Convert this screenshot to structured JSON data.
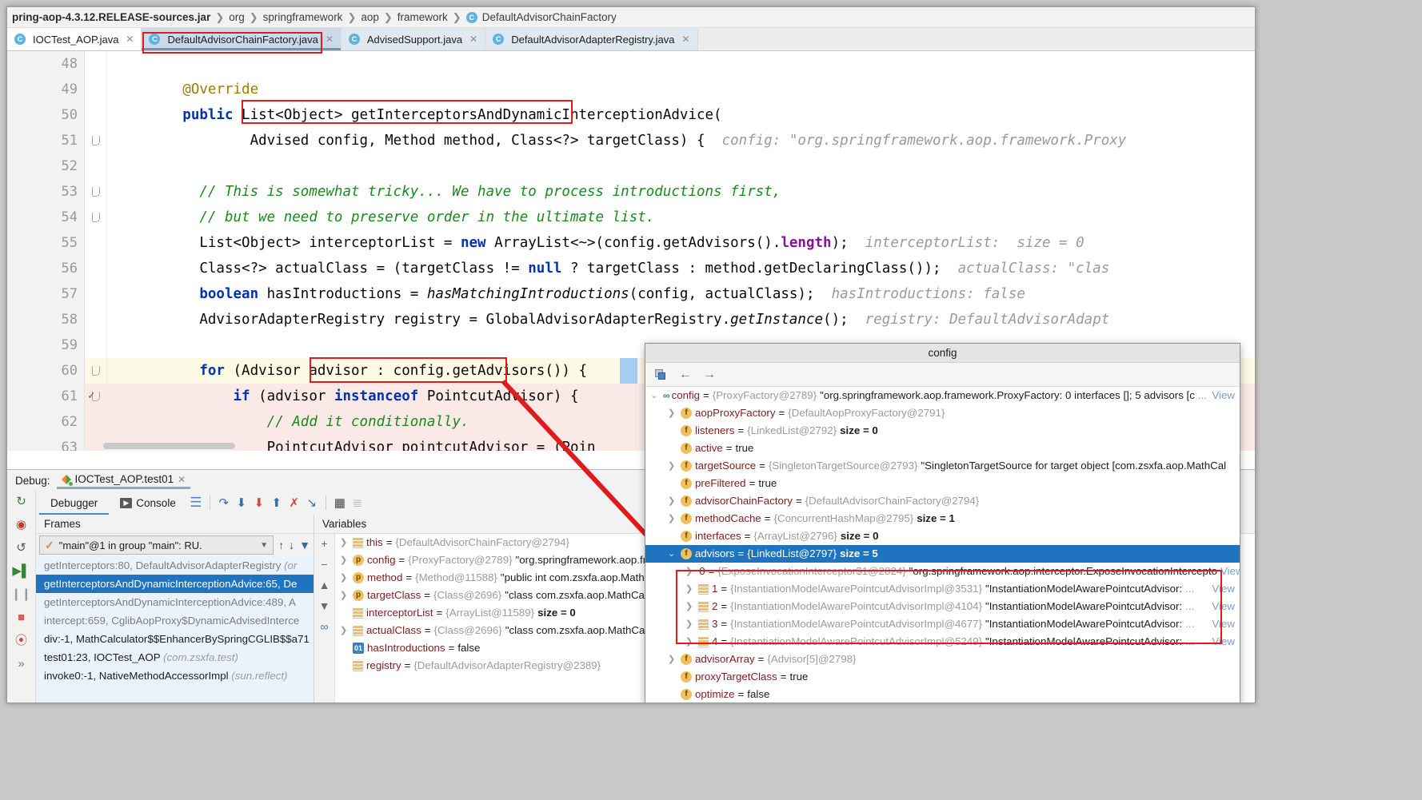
{
  "breadcrumb": {
    "root": "pring-aop-4.3.12.RELEASE-sources.jar",
    "items": [
      "org",
      "springframework",
      "aop",
      "framework"
    ],
    "leaf": "DefaultAdvisorChainFactory",
    "leaf_badge": "C"
  },
  "editor_tabs": [
    {
      "label": "IOCTest_AOP.java",
      "badge": "C",
      "active": false
    },
    {
      "label": "DefaultAdvisorChainFactory.java",
      "badge": "C",
      "active": true
    },
    {
      "label": "AdvisedSupport.java",
      "badge": "C",
      "active": false
    },
    {
      "label": "DefaultAdvisorAdapterRegistry.java",
      "badge": "C",
      "active": false
    }
  ],
  "code": {
    "lines": [
      {
        "num": "48",
        "segments": []
      },
      {
        "num": "49",
        "segments": [
          {
            "t": "        ",
            "c": ""
          },
          {
            "t": "@Override",
            "c": "ann"
          }
        ]
      },
      {
        "num": "50",
        "segments": [
          {
            "t": "        ",
            "c": ""
          },
          {
            "t": "public",
            "c": "kw"
          },
          {
            "t": " List<Object> getInterceptorsAndDynamicInterceptionAdvice(",
            "c": ""
          }
        ],
        "marks": [
          "breakpoint-green",
          "arrow-up"
        ]
      },
      {
        "num": "51",
        "segments": [
          {
            "t": "                Advised config, Method method, Class<?> targetClass) {  ",
            "c": ""
          },
          {
            "t": "config: \"org.springframework.aop.framework.Proxy",
            "c": "hint"
          }
        ],
        "fold": true
      },
      {
        "num": "52",
        "segments": []
      },
      {
        "num": "53",
        "segments": [
          {
            "t": "          ",
            "c": ""
          },
          {
            "t": "// This is somewhat tricky... We have to process introductions first,",
            "c": "cmt"
          }
        ],
        "fold": true
      },
      {
        "num": "54",
        "segments": [
          {
            "t": "          ",
            "c": ""
          },
          {
            "t": "// but we need to preserve order in the ultimate list.",
            "c": "cmt"
          }
        ],
        "fold": true
      },
      {
        "num": "55",
        "segments": [
          {
            "t": "          List<Object> interceptorList = ",
            "c": ""
          },
          {
            "t": "new",
            "c": "kw"
          },
          {
            "t": " ArrayList<~>(config.getAdvisors().",
            "c": ""
          },
          {
            "t": "length",
            "c": "fld"
          },
          {
            "t": ");  ",
            "c": ""
          },
          {
            "t": "interceptorList:  size = 0",
            "c": "hint"
          }
        ]
      },
      {
        "num": "56",
        "segments": [
          {
            "t": "          Class<?> actualClass = (targetClass != ",
            "c": ""
          },
          {
            "t": "null",
            "c": "kw"
          },
          {
            "t": " ? targetClass : method.getDeclaringClass());  ",
            "c": ""
          },
          {
            "t": "actualClass: \"clas",
            "c": "hint"
          }
        ]
      },
      {
        "num": "57",
        "segments": [
          {
            "t": "          ",
            "c": ""
          },
          {
            "t": "boolean",
            "c": "kw"
          },
          {
            "t": " hasIntroductions = ",
            "c": ""
          },
          {
            "t": "hasMatchingIntroductions",
            "c": "ital"
          },
          {
            "t": "(config, actualClass);  ",
            "c": ""
          },
          {
            "t": "hasIntroductions: false",
            "c": "hint"
          }
        ]
      },
      {
        "num": "58",
        "segments": [
          {
            "t": "          AdvisorAdapterRegistry registry = GlobalAdvisorAdapterRegistry.",
            "c": ""
          },
          {
            "t": "getInstance",
            "c": "ital"
          },
          {
            "t": "();  ",
            "c": ""
          },
          {
            "t": "registry: DefaultAdvisorAdapt",
            "c": "hint"
          }
        ]
      },
      {
        "num": "59",
        "segments": []
      },
      {
        "num": "60",
        "segments": [
          {
            "t": "          ",
            "c": ""
          },
          {
            "t": "for",
            "c": "kw"
          },
          {
            "t": " (Advisor advisor : config.getAdvisors()) {",
            "c": ""
          }
        ],
        "hl": "yellow",
        "fold": true
      },
      {
        "num": "61",
        "segments": [
          {
            "t": "              ",
            "c": ""
          },
          {
            "t": "if",
            "c": "kw"
          },
          {
            "t": " (advisor ",
            "c": ""
          },
          {
            "t": "instanceof",
            "c": "kw"
          },
          {
            "t": " PointcutAdvisor) {",
            "c": ""
          }
        ],
        "hl": "pink",
        "marks": [
          "breakpoint-red"
        ],
        "fold": true
      },
      {
        "num": "62",
        "segments": [
          {
            "t": "                  ",
            "c": ""
          },
          {
            "t": "// Add it conditionally.",
            "c": "cmt"
          }
        ],
        "hl": "pink"
      },
      {
        "num": "63",
        "segments": [
          {
            "t": "                  PointcutAdvisor pointcutAdvisor = (Poin",
            "c": ""
          }
        ],
        "hl": "pink"
      }
    ]
  },
  "debug": {
    "label": "Debug:",
    "run_config": "IOCTest_AOP.test01",
    "tabs": [
      {
        "label": "Debugger",
        "active": true
      },
      {
        "label": "Console",
        "active": false
      }
    ],
    "toolbar_icons": [
      "mute-breakpoints-icon",
      "step-over-icon",
      "step-into-icon",
      "force-step-into-icon",
      "step-out-icon",
      "drop-frame-icon",
      "run-to-cursor-icon",
      "evaluate-expression-icon",
      "settings-icon"
    ],
    "rail_icons": [
      "rerun-icon",
      "view-breakpoints-icon",
      "restore-layout-icon",
      "resume-icon",
      "pause-icon",
      "stop-icon",
      "mute-breakpoints-rail-icon",
      "more-icon"
    ],
    "frames_title": "Frames",
    "thread": "\"main\"@1 in group \"main\": RU.",
    "frames": [
      {
        "text": "getInterceptors:80, DefaultAdvisorAdapterRegistry ",
        "lib": "(or",
        "selected": false,
        "dark": false
      },
      {
        "text": "getInterceptorsAndDynamicInterceptionAdvice:65, De",
        "lib": "",
        "selected": true,
        "dark": false
      },
      {
        "text": "getInterceptorsAndDynamicInterceptionAdvice:489, A",
        "lib": "",
        "selected": false,
        "dark": false
      },
      {
        "text": "intercept:659, CglibAopProxy$DynamicAdvisedInterce",
        "lib": "",
        "selected": false,
        "dark": false
      },
      {
        "text": "div:-1, MathCalculator$$EnhancerBySpringCGLIB$$a71",
        "lib": "",
        "selected": false,
        "dark": true
      },
      {
        "text": "test01:23, IOCTest_AOP ",
        "lib": "(com.zsxfa.test)",
        "selected": false,
        "dark": true
      },
      {
        "text": "invoke0:-1, NativeMethodAccessorImpl ",
        "lib": "(sun.reflect)",
        "selected": false,
        "dark": true
      }
    ],
    "vars_title": "Variables",
    "variables": [
      {
        "icon": "local",
        "name": "this",
        "ref": "{DefaultAdvisorChainFactory@2794}",
        "str": "",
        "size": "",
        "expandable": true
      },
      {
        "icon": "param",
        "name": "config",
        "ref": "{ProxyFactory@2789}",
        "str": "\"org.springframework.aop.fr",
        "size": "",
        "expandable": true
      },
      {
        "icon": "param",
        "name": "method",
        "ref": "{Method@11588}",
        "str": "\"public int com.zsxfa.aop.Math",
        "size": "",
        "expandable": true
      },
      {
        "icon": "param",
        "name": "targetClass",
        "ref": "{Class@2696}",
        "str": "\"class com.zsxfa.aop.MathCalcu",
        "size": "",
        "expandable": true
      },
      {
        "icon": "local",
        "name": "interceptorList",
        "ref": "{ArrayList@11589}",
        "str": "",
        "size": "size = 0",
        "expandable": false
      },
      {
        "icon": "local",
        "name": "actualClass",
        "ref": "{Class@2696}",
        "str": "\"class com.zsxfa.aop.MathCalcu",
        "size": "",
        "expandable": true
      },
      {
        "icon": "bool",
        "name": "hasIntroductions",
        "ref": "",
        "str": "false",
        "size": "",
        "expandable": false
      },
      {
        "icon": "local",
        "name": "registry",
        "ref": "{DefaultAdvisorAdapterRegistry@2389}",
        "str": "",
        "size": "",
        "expandable": false
      }
    ]
  },
  "popup": {
    "title": "config",
    "toolbar_icons": [
      "watch-icon",
      "back-arrow-icon",
      "forward-arrow-icon"
    ],
    "rows": [
      {
        "indent": 0,
        "twisty": "v",
        "icon": "oo",
        "name": "config",
        "ref": "{ProxyFactory@2789}",
        "str": "\"org.springframework.aop.framework.ProxyFactory: 0 interfaces []; 5 advisors [c",
        "ell": "...",
        "view": "View",
        "selected": false
      },
      {
        "indent": 1,
        "twisty": ">",
        "icon": "field",
        "name": "aopProxyFactory",
        "ref": "{DefaultAopProxyFactory@2791}",
        "str": "",
        "ell": "",
        "view": "",
        "selected": false
      },
      {
        "indent": 1,
        "twisty": "",
        "icon": "field",
        "name": "listeners",
        "ref": "{LinkedList@2792}",
        "str": "",
        "size": "size = 0",
        "ell": "",
        "view": "",
        "selected": false
      },
      {
        "indent": 1,
        "twisty": "",
        "icon": "field",
        "name": "active",
        "ref": "",
        "str": "true",
        "ell": "",
        "view": "",
        "selected": false
      },
      {
        "indent": 1,
        "twisty": ">",
        "icon": "field",
        "name": "targetSource",
        "ref": "{SingletonTargetSource@2793}",
        "str": "\"SingletonTargetSource for target object [com.zsxfa.aop.MathCal",
        "ell": "",
        "view": "",
        "selected": false
      },
      {
        "indent": 1,
        "twisty": "",
        "icon": "field",
        "name": "preFiltered",
        "ref": "",
        "str": "true",
        "ell": "",
        "view": "",
        "selected": false
      },
      {
        "indent": 1,
        "twisty": ">",
        "icon": "field",
        "name": "advisorChainFactory",
        "ref": "{DefaultAdvisorChainFactory@2794}",
        "str": "",
        "ell": "",
        "view": "",
        "selected": false
      },
      {
        "indent": 1,
        "twisty": ">",
        "icon": "field",
        "name": "methodCache",
        "ref": "{ConcurrentHashMap@2795}",
        "str": "",
        "size": "size = 1",
        "ell": "",
        "view": "",
        "selected": false
      },
      {
        "indent": 1,
        "twisty": "",
        "icon": "field",
        "name": "interfaces",
        "ref": "{ArrayList@2796}",
        "str": "",
        "size": "size = 0",
        "ell": "",
        "view": "",
        "selected": false
      },
      {
        "indent": 1,
        "twisty": "v",
        "icon": "field",
        "name": "advisors",
        "ref": "{LinkedList@2797}",
        "str": "",
        "size": "size = 5",
        "ell": "",
        "view": "",
        "selected": true
      },
      {
        "indent": 2,
        "twisty": ">",
        "icon": "local",
        "name": "0",
        "ref": "{ExposeInvocationInterceptor$1@2824}",
        "str": "\"org.springframework.aop.interceptor.ExposeInvocationIntercepto",
        "ell": "",
        "view": "View",
        "selected": false
      },
      {
        "indent": 2,
        "twisty": ">",
        "icon": "local",
        "name": "1",
        "ref": "{InstantiationModelAwarePointcutAdvisorImpl@3531}",
        "str": "\"InstantiationModelAwarePointcutAdvisor: ",
        "ell": "...",
        "view": "View",
        "selected": false
      },
      {
        "indent": 2,
        "twisty": ">",
        "icon": "local",
        "name": "2",
        "ref": "{InstantiationModelAwarePointcutAdvisorImpl@4104}",
        "str": "\"InstantiationModelAwarePointcutAdvisor: ",
        "ell": "...",
        "view": "View",
        "selected": false
      },
      {
        "indent": 2,
        "twisty": ">",
        "icon": "local",
        "name": "3",
        "ref": "{InstantiationModelAwarePointcutAdvisorImpl@4677}",
        "str": "\"InstantiationModelAwarePointcutAdvisor: ",
        "ell": "...",
        "view": "View",
        "selected": false
      },
      {
        "indent": 2,
        "twisty": ">",
        "icon": "local",
        "name": "4",
        "ref": "{InstantiationModelAwarePointcutAdvisorImpl@5249}",
        "str": "\"InstantiationModelAwarePointcutAdvisor: ",
        "ell": "...",
        "view": "View",
        "selected": false
      },
      {
        "indent": 1,
        "twisty": ">",
        "icon": "field",
        "name": "advisorArray",
        "ref": "{Advisor[5]@2798}",
        "str": "",
        "ell": "",
        "view": "",
        "selected": false
      },
      {
        "indent": 1,
        "twisty": "",
        "icon": "field",
        "name": "proxyTargetClass",
        "ref": "",
        "str": "true",
        "ell": "",
        "view": "",
        "selected": false
      },
      {
        "indent": 1,
        "twisty": "",
        "icon": "field",
        "name": "optimize",
        "ref": "",
        "str": "false",
        "ell": "",
        "view": "",
        "selected": false
      }
    ]
  },
  "annotations": {
    "highlight_color": "#e01b1b",
    "arrow_color": "#e01b1b"
  }
}
